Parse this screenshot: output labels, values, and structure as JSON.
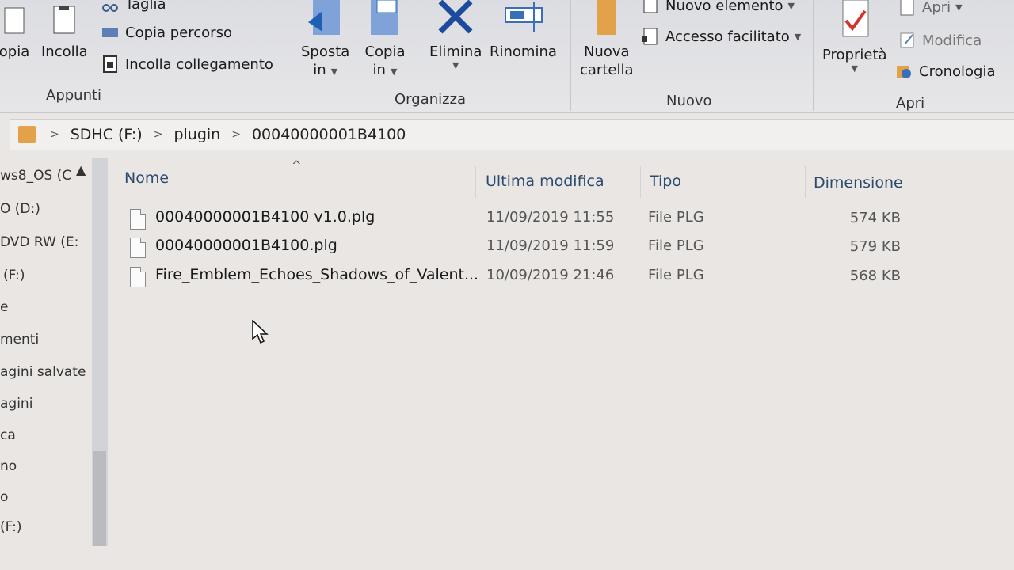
{
  "ribbon": {
    "appunti": {
      "label": "Appunti",
      "copy_partial": "opia",
      "paste": "Incolla",
      "cut": "Taglia",
      "copy_path": "Copia percorso",
      "paste_link": "Incolla collegamento"
    },
    "organizza": {
      "label": "Organizza",
      "move_to": [
        "Sposta",
        "in"
      ],
      "copy_to": [
        "Copia",
        "in"
      ],
      "delete": "Elimina",
      "rename": "Rinomina"
    },
    "nuovo": {
      "label": "Nuovo",
      "new_folder": [
        "Nuova",
        "cartella"
      ],
      "new_item": "Nuovo elemento",
      "easy_access": "Accesso facilitato"
    },
    "apri": {
      "label": "Apri",
      "properties": "Proprietà",
      "open": "Apri",
      "edit": "Modifica",
      "history": "Cronologia"
    }
  },
  "address": {
    "crumbs": [
      "SDHC (F:)",
      "plugin",
      "00040000001B4100"
    ]
  },
  "nav": {
    "items": [
      "ws8_OS (C",
      "O (D:)",
      "DVD RW (E:",
      "(F:)",
      "e",
      "menti",
      "agini salvate",
      "agini",
      "ca",
      "no",
      "o",
      "(F:)"
    ]
  },
  "columns": {
    "name": "Nome",
    "modified": "Ultima modifica",
    "type": "Tipo",
    "size": "Dimensione"
  },
  "files": [
    {
      "name": "00040000001B4100 v1.0.plg",
      "modified": "11/09/2019 11:55",
      "type": "File PLG",
      "size": "574 KB"
    },
    {
      "name": "00040000001B4100.plg",
      "modified": "11/09/2019 11:59",
      "type": "File PLG",
      "size": "579 KB"
    },
    {
      "name": "Fire_Emblem_Echoes_Shadows_of_Valent...",
      "modified": "10/09/2019 21:46",
      "type": "File PLG",
      "size": "568 KB"
    }
  ],
  "icons": {
    "delete": "close-x-icon",
    "properties": "checkmark-icon",
    "folder_color": "#e1a24a"
  }
}
